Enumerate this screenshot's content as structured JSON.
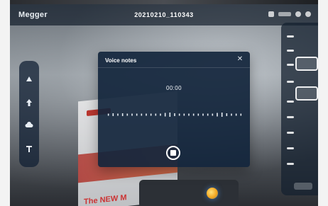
{
  "header": {
    "app_name": "Megger",
    "file_name": "20210210_110343"
  },
  "dialog": {
    "title": "Voice notes",
    "timer": "00:00"
  },
  "left_toolbar": {
    "icons": [
      "shape-icon",
      "arrow-up-icon",
      "cloud-icon",
      "text-icon"
    ]
  },
  "scene": {
    "sign_text": "The NEW M"
  },
  "colors": {
    "dialog_bg": "#12253c",
    "toolbar_bg": "#122034",
    "accent": "#f2a21a"
  }
}
